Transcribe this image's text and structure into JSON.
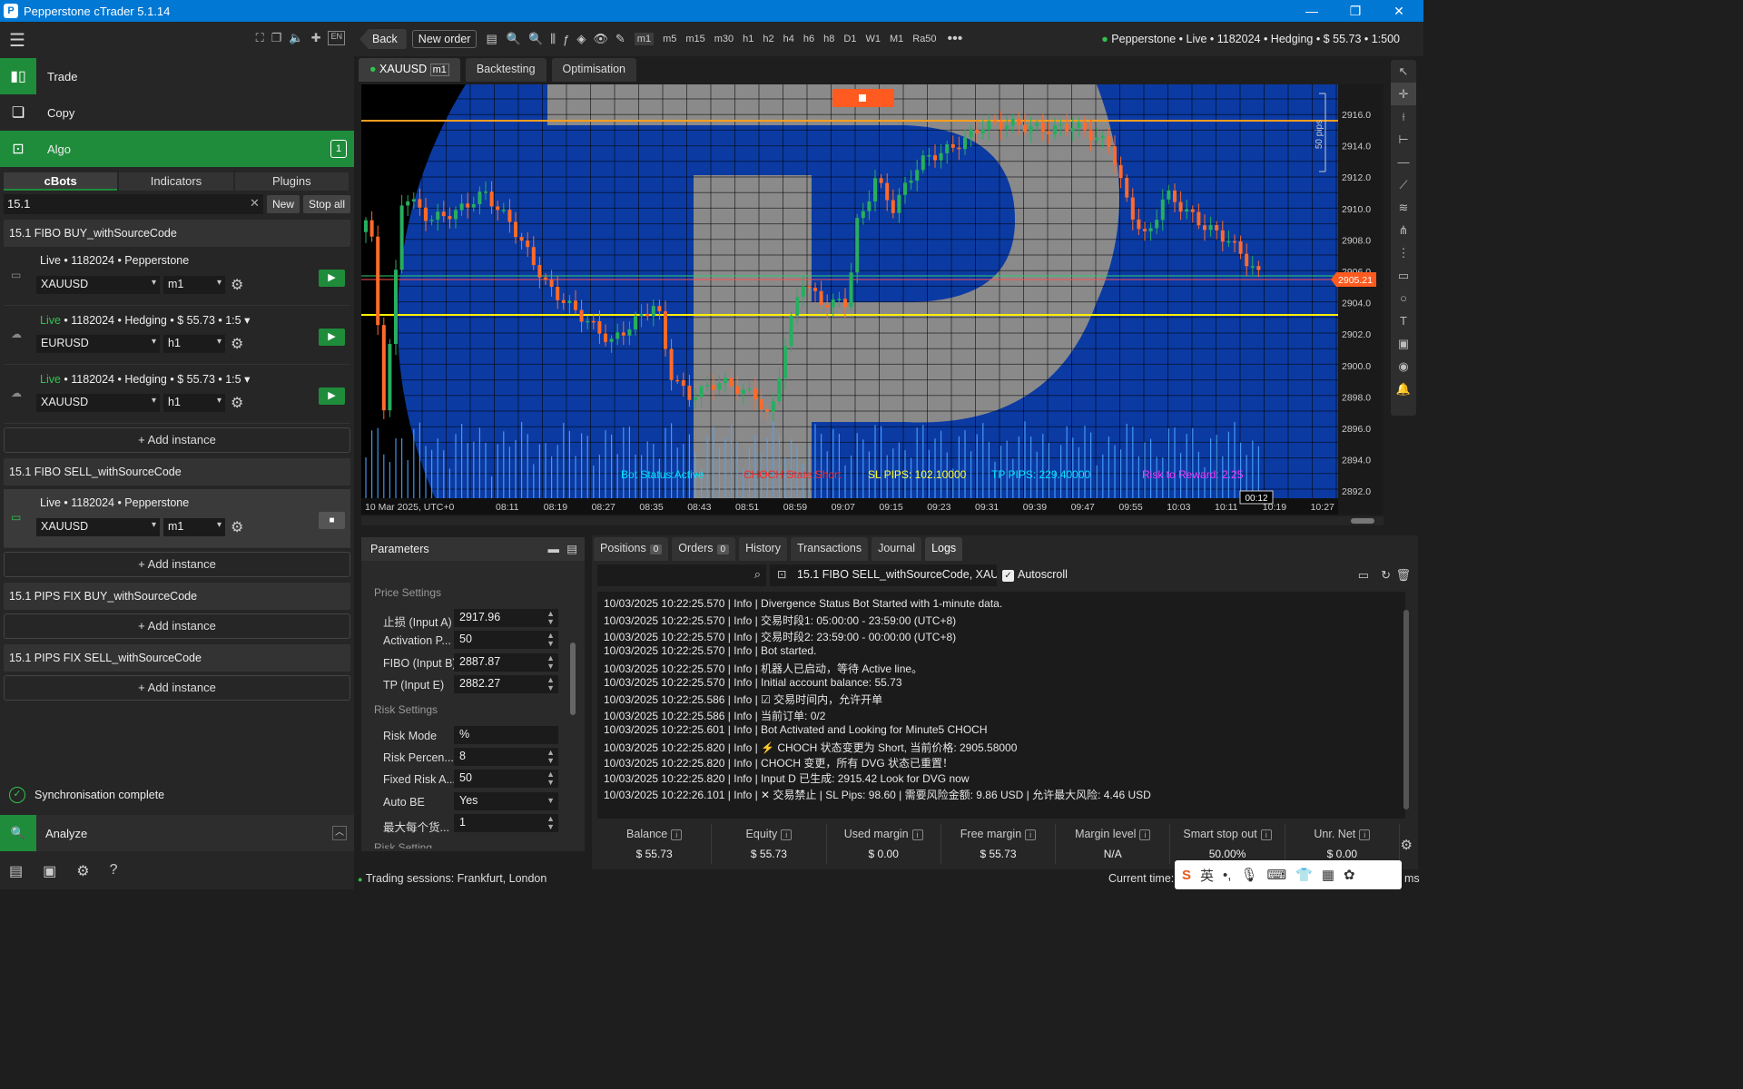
{
  "window": {
    "title": "Pepperstone cTrader 5.1.14"
  },
  "nav": {
    "trade": "Trade",
    "copy": "Copy",
    "algo": "Algo",
    "algo_badge": "1",
    "analyze": "Analyze",
    "lang": "EN"
  },
  "algo": {
    "tabs": [
      "cBots",
      "Indicators",
      "Plugins"
    ],
    "search_value": "15.1",
    "new_label": "New",
    "stop_all_label": "Stop all",
    "groups": [
      {
        "name": "15.1 FIBO BUY_withSourceCode"
      },
      {
        "name": "15.1 FIBO SELL_withSourceCode"
      },
      {
        "name": "15.1 PIPS FIX BUY_withSourceCode"
      },
      {
        "name": "15.1 PIPS FIX SELL_withSourceCode"
      }
    ],
    "instances": [
      {
        "live": "",
        "account": "Live • 1182024 •  Pepperstone",
        "symbol": "XAUUSD",
        "tf": "m1"
      },
      {
        "live": "Live",
        "account": " • 1182024 • Hedging • $ 55.73 • 1:5",
        "symbol": "EURUSD",
        "tf": "h1"
      },
      {
        "live": "Live",
        "account": " • 1182024 • Hedging • $ 55.73 • 1:5",
        "symbol": "XAUUSD",
        "tf": "h1"
      },
      {
        "live": "",
        "account": "Live • 1182024 •  Pepperstone",
        "symbol": "XAUUSD",
        "tf": "m1"
      }
    ],
    "add_instance": "Add instance",
    "sync": "Synchronisation complete"
  },
  "toolbar": {
    "back": "Back",
    "new_order": "New order",
    "timeframes": [
      "m1",
      "m5",
      "m15",
      "m30",
      "h1",
      "h2",
      "h4",
      "h6",
      "h8",
      "D1",
      "W1",
      "M1",
      "Ra50"
    ],
    "account": "Pepperstone • Live • 1182024 • Hedging • $ 55.73 • 1:500"
  },
  "chart_tabs": {
    "symbol": "XAUUSD",
    "tf": "m1",
    "backtesting": "Backtesting",
    "optimisation": "Optimisation"
  },
  "chart": {
    "price_labels": [
      "2916.0",
      "2914.0",
      "2912.0",
      "2910.0",
      "2908.0",
      "2906.0",
      "2904.0",
      "2902.0",
      "2900.0",
      "2898.0",
      "2896.0",
      "2894.0",
      "2892.0"
    ],
    "time_labels": [
      "10 Mar 2025, UTC+0",
      "08:11",
      "08:19",
      "08:27",
      "08:35",
      "08:43",
      "08:51",
      "08:59",
      "09:07",
      "09:15",
      "09:23",
      "09:31",
      "09:39",
      "09:47",
      "09:55",
      "10:03",
      "10:11",
      "10:19",
      "10:27"
    ],
    "current_price": "2905.21",
    "pips_label": "50 pips",
    "countdown": "00:12",
    "status": [
      {
        "text": "Bot Status:Active",
        "color": "#00e5ff"
      },
      {
        "text": "CHOCH State:Short",
        "color": "#ff2a2a"
      },
      {
        "text": "SL PIPS: 102.10000",
        "color": "#ffff33"
      },
      {
        "text": "TP PIPS: 229.40000",
        "color": "#00e5ff"
      },
      {
        "text": "Risk to Reward: 2.25",
        "color": "#ff33ff"
      }
    ]
  },
  "parameters": {
    "title": "Parameters",
    "sections": {
      "price": "Price Settings",
      "risk": "Risk Settings",
      "risk2": "Risk Setting"
    },
    "rows": [
      {
        "label": "止损 (Input A)",
        "value": "2917.96"
      },
      {
        "label": "Activation P...",
        "value": "50"
      },
      {
        "label": "FIBO (Input B)",
        "value": "2887.87"
      },
      {
        "label": "TP (Input E)",
        "value": "2882.27"
      },
      {
        "label": "Risk Mode",
        "value": "%"
      },
      {
        "label": "Risk Percen...",
        "value": "8"
      },
      {
        "label": "Fixed Risk A...",
        "value": "50"
      },
      {
        "label": "Auto BE",
        "value": "Yes"
      },
      {
        "label": "最大每个货...",
        "value": "1"
      }
    ]
  },
  "logs": {
    "tabs": [
      {
        "label": "Positions",
        "count": "0"
      },
      {
        "label": "Orders",
        "count": "0"
      },
      {
        "label": "History"
      },
      {
        "label": "Transactions"
      },
      {
        "label": "Journal"
      },
      {
        "label": "Logs"
      }
    ],
    "bot_select": "15.1 FIBO SELL_withSourceCode, XAUUSD",
    "autoscroll": "Autoscroll",
    "lines": [
      "10/03/2025 10:22:25.570 | Info | Divergence Status Bot Started with 1-minute data.",
      "10/03/2025 10:22:25.570 | Info | 交易时段1: 05:00:00 - 23:59:00 (UTC+8)",
      "10/03/2025 10:22:25.570 | Info | 交易时段2: 23:59:00 - 00:00:00 (UTC+8)",
      "10/03/2025 10:22:25.570 | Info | Bot started.",
      "10/03/2025 10:22:25.570 | Info | 机器人已启动，等待 Active line。",
      "10/03/2025 10:22:25.570 | Info | Initial account balance: 55.73",
      "10/03/2025 10:22:25.586 | Info | ☑ 交易时间内，允许开单",
      "10/03/2025 10:22:25.586 | Info | 当前订单: 0/2",
      "10/03/2025 10:22:25.601 | Info | Bot Activated and Looking for Minute5 CHOCH",
      "10/03/2025 10:22:25.820 | Info | ⚡ CHOCH 状态变更为 Short, 当前价格: 2905.58000",
      "10/03/2025 10:22:25.820 | Info | CHOCH 变更，所有 DVG 状态已重置！",
      "10/03/2025 10:22:25.820 | Info | Input D 已生成: 2915.42 Look for DVG now",
      "10/03/2025 10:22:26.101 | Info | ✕ 交易禁止 | SL Pips: 98.60 | 需要风险金额: 9.86 USD | 允许最大风险: 4.46 USD"
    ],
    "stats": [
      {
        "k": "Balance",
        "v": "$ 55.73"
      },
      {
        "k": "Equity",
        "v": "$ 55.73"
      },
      {
        "k": "Used margin",
        "v": "$ 0.00"
      },
      {
        "k": "Free margin",
        "v": "$ 55.73"
      },
      {
        "k": "Margin level",
        "v": "N/A"
      },
      {
        "k": "Smart stop out",
        "v": "50.00%"
      },
      {
        "k": "Unr. Net",
        "v": "$ 0.00"
      }
    ]
  },
  "status_bar": {
    "sessions": "Trading sessions: Frankfurt, London",
    "current_time": "Current time:",
    "ms": "ms"
  },
  "ime": {
    "lang": "英"
  }
}
